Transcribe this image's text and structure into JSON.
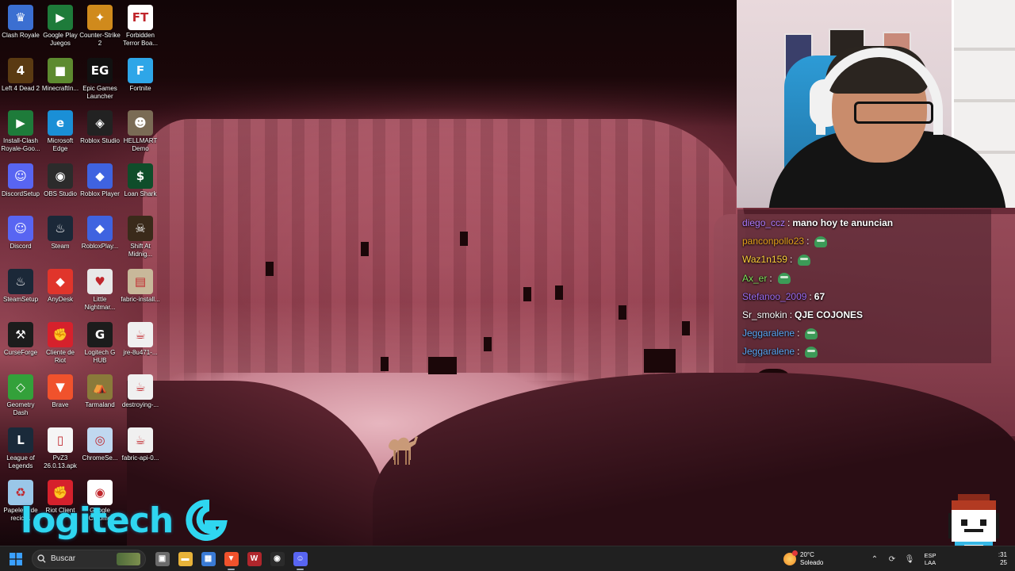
{
  "desktop": {
    "icons": [
      {
        "label": "Clash Royale",
        "color": "#3b6fd1",
        "glyph": "♛"
      },
      {
        "label": "Google Play Juegos",
        "color": "#1e7b3a",
        "glyph": "▶"
      },
      {
        "label": "Counter-Strike 2",
        "color": "#d08a1c",
        "glyph": "✦"
      },
      {
        "label": "Forbidden Terror Boa...",
        "color": "#ffffff",
        "glyph": "FT"
      },
      {
        "label": "Left 4 Dead 2",
        "color": "#5a3a12",
        "glyph": "4"
      },
      {
        "label": "MinecraftIn...",
        "color": "#5d8a2f",
        "glyph": "■"
      },
      {
        "label": "Epic Games Launcher",
        "color": "#111111",
        "glyph": "EG"
      },
      {
        "label": "Fortnite",
        "color": "#2ea6e8",
        "glyph": "F"
      },
      {
        "label": "Install-Clash Royale-Goo...",
        "color": "#1e7b3a",
        "glyph": "▶"
      },
      {
        "label": "Microsoft Edge",
        "color": "#1a8fd6",
        "glyph": "e"
      },
      {
        "label": "Roblox Studio",
        "color": "#222222",
        "glyph": "◈"
      },
      {
        "label": "HELLMART Demo",
        "color": "#7a6b55",
        "glyph": "☻"
      },
      {
        "label": "DiscordSetup",
        "color": "#5865f2",
        "glyph": "☺"
      },
      {
        "label": "OBS Studio",
        "color": "#2b2b2b",
        "glyph": "◉"
      },
      {
        "label": "Roblox Player",
        "color": "#3f63e0",
        "glyph": "◆"
      },
      {
        "label": "Loan Shark",
        "color": "#0f4d2a",
        "glyph": "$"
      },
      {
        "label": "Discord",
        "color": "#5865f2",
        "glyph": "☺"
      },
      {
        "label": "Steam",
        "color": "#1b2838",
        "glyph": "♨"
      },
      {
        "label": "RobloxPlay...",
        "color": "#3f63e0",
        "glyph": "◆"
      },
      {
        "label": "Shift At Midnig...",
        "color": "#3a2a1a",
        "glyph": "☠"
      },
      {
        "label": "SteamSetup",
        "color": "#1b2838",
        "glyph": "♨"
      },
      {
        "label": "AnyDesk",
        "color": "#e0352b",
        "glyph": "◆"
      },
      {
        "label": "Little Nightmar...",
        "color": "#e8e8e8",
        "glyph": "♥"
      },
      {
        "label": "fabric-install...",
        "color": "#c8b89a",
        "glyph": "▤"
      },
      {
        "label": "CurseForge",
        "color": "#1c1c1c",
        "glyph": "⚒"
      },
      {
        "label": "Cliente de Riot",
        "color": "#d6212c",
        "glyph": "✊"
      },
      {
        "label": "Logitech G HUB",
        "color": "#1c1c1c",
        "glyph": "G"
      },
      {
        "label": "jre-8u471-...",
        "color": "#f0f0f0",
        "glyph": "☕"
      },
      {
        "label": "Geometry Dash",
        "color": "#33a13a",
        "glyph": "◇"
      },
      {
        "label": "Brave",
        "color": "#f0522c",
        "glyph": "▼"
      },
      {
        "label": "Tarmaland",
        "color": "#8a7a3a",
        "glyph": "⛺"
      },
      {
        "label": "destroying-...",
        "color": "#f0f0f0",
        "glyph": "☕"
      },
      {
        "label": "League of Legends",
        "color": "#1a2a3a",
        "glyph": "L"
      },
      {
        "label": "PvZ3 26.0.13.apk",
        "color": "#f5f5f5",
        "glyph": "▯"
      },
      {
        "label": "ChromeSe...",
        "color": "#c0d8f0",
        "glyph": "◎"
      },
      {
        "label": "fabric-api-0...",
        "color": "#f0f0f0",
        "glyph": "☕"
      },
      {
        "label": "Papelera de recicl...",
        "color": "#9ac7e8",
        "glyph": "♻"
      },
      {
        "label": "Riot Client",
        "color": "#d6212c",
        "glyph": "✊"
      },
      {
        "label": "Google Chrome",
        "color": "#ffffff",
        "glyph": "◉"
      }
    ]
  },
  "overlay": {
    "logitech_text": "logitech"
  },
  "chat": {
    "messages": [
      {
        "user": "diego_ccz",
        "color": "#b07bff",
        "text": "mano hoy te anuncian",
        "emote": false
      },
      {
        "user": "panconpollo23",
        "color": "#e6a21c",
        "text": "",
        "emote": true
      },
      {
        "user": "Waz1n159",
        "color": "#ffcf3a",
        "text": "",
        "emote": true
      },
      {
        "user": "Ax_er",
        "color": "#7ee05a",
        "text": "",
        "emote": true
      },
      {
        "user": "Stefanoo_2009",
        "color": "#9b6cf0",
        "text": "67",
        "emote": false
      },
      {
        "user": "Sr_smokin",
        "color": "#ffffff",
        "text": "QJE COJONES",
        "emote": false
      },
      {
        "user": "Jeggaralene",
        "color": "#5aa7f5",
        "text": "",
        "emote": true
      },
      {
        "user": "Jeggaralene",
        "color": "#5aa7f5",
        "text": "",
        "emote": true
      }
    ]
  },
  "taskbar": {
    "search_placeholder": "Buscar",
    "apps": [
      {
        "name": "task-view",
        "color": "#6b6b6b",
        "glyph": "▣",
        "active": false
      },
      {
        "name": "file-explorer",
        "color": "#e8b339",
        "glyph": "▬",
        "active": false
      },
      {
        "name": "store",
        "color": "#3a7bd5",
        "glyph": "▦",
        "active": false
      },
      {
        "name": "brave",
        "color": "#f0522c",
        "glyph": "▼",
        "active": true
      },
      {
        "name": "game",
        "color": "#b0262c",
        "glyph": "W",
        "active": false
      },
      {
        "name": "obs",
        "color": "#2b2b2b",
        "glyph": "◉",
        "active": false
      },
      {
        "name": "discord",
        "color": "#5865f2",
        "glyph": "☺",
        "active": true
      }
    ],
    "weather_temp": "20°C",
    "weather_desc": "Soleado",
    "lang_top": "ESP",
    "lang_bottom": "LAA",
    "clock_time": ":31",
    "clock_date": "25"
  }
}
